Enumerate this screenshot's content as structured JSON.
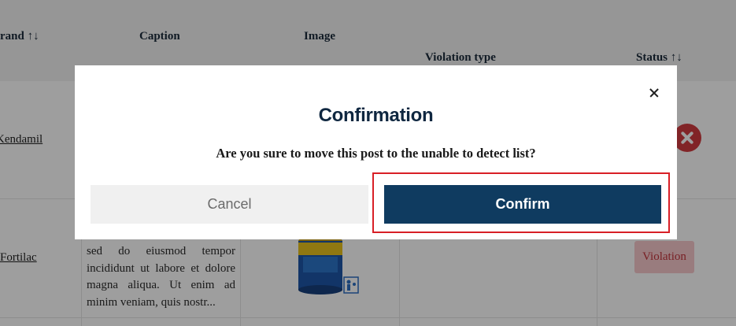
{
  "table": {
    "headers": {
      "brand": "rand ↑↓",
      "caption": "Caption",
      "image": "Image",
      "violation_type": "Violation type",
      "status": "Status ↑↓"
    },
    "rows": [
      {
        "brand": "Kendamil",
        "status_icon": "reject-icon"
      },
      {
        "brand": "Fortilac",
        "caption": "sed do eiusmod tempor incididunt ut labore et dolore magna aliqua. Ut enim ad minim veniam, quis nostr...",
        "status": "Violation"
      }
    ]
  },
  "modal": {
    "title": "Confirmation",
    "message": "Are you sure to move this post to the unable to detect list?",
    "cancel_label": "Cancel",
    "confirm_label": "Confirm",
    "close_icon": "close-icon"
  },
  "colors": {
    "primary": "#0f3b60",
    "highlight": "#d81f26",
    "violation_bg": "#f7c8cc",
    "violation_text": "#c2323a"
  }
}
